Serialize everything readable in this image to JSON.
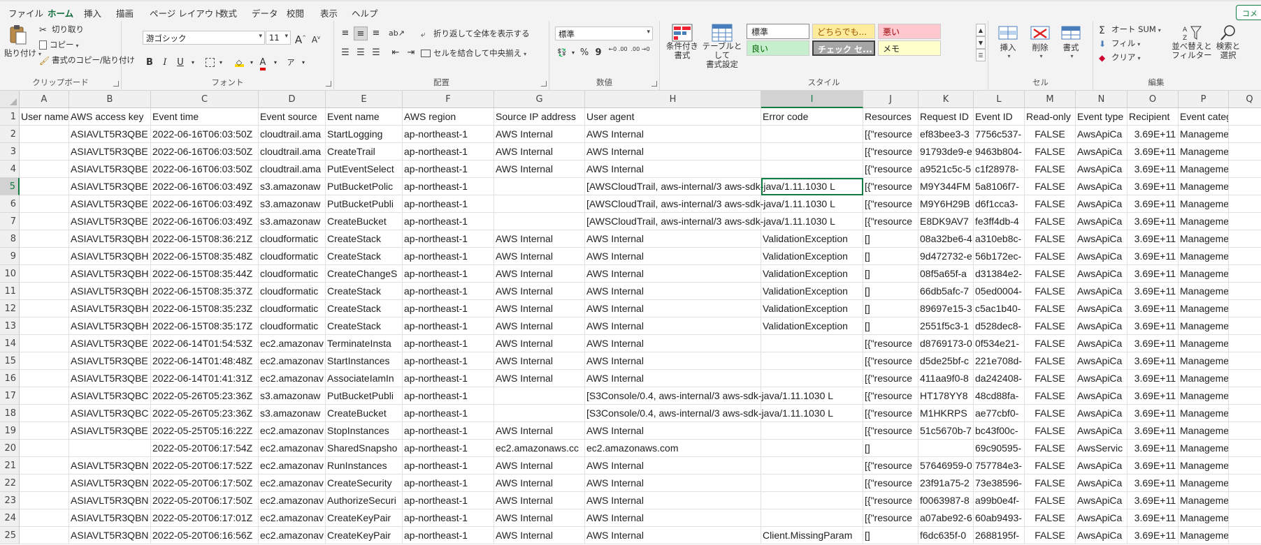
{
  "ribbon_tabs": [
    "ファイル",
    "ホーム",
    "挿入",
    "描画",
    "ページ レイアウト",
    "数式",
    "データ",
    "校閲",
    "表示",
    "ヘルプ"
  ],
  "active_tab": "ホーム",
  "comment_button": "コメ",
  "clipboard": {
    "paste": "貼り付け",
    "cut": "切り取り",
    "copy": "コピー",
    "format_painter": "書式のコピー/貼り付け",
    "label": "クリップボード"
  },
  "font": {
    "name": "游ゴシック",
    "size": "11",
    "grow": "A",
    "shrink": "A",
    "bold": "B",
    "italic": "I",
    "underline": "U",
    "color_letter": "A",
    "label": "フォント"
  },
  "alignment": {
    "wrap_text": "折り返して全体を表示する",
    "merge_center": "セルを結合して中央揃え",
    "label": "配置"
  },
  "number": {
    "format": "標準",
    "percent": "%",
    "comma": "9",
    "inc_decimal": "←0 .00",
    "dec_decimal": ".00 →0",
    "label": "数値"
  },
  "styles": {
    "conditional": "条件付き\n書式",
    "as_table": "テーブルとして\n書式設定",
    "cells": [
      {
        "text": "標準",
        "bg": "#ffffff",
        "fg": "#222222"
      },
      {
        "text": "どちらでも...",
        "bg": "#ffeb9c",
        "fg": "#9c5700"
      },
      {
        "text": "悪い",
        "bg": "#ffc7ce",
        "fg": "#9c0006"
      },
      {
        "text": "良い",
        "bg": "#c6efce",
        "fg": "#006100"
      },
      {
        "text": "チェック セ...",
        "bg": "#a5a5a5",
        "fg": "#ffffff"
      },
      {
        "text": "メモ",
        "bg": "#ffffcc",
        "fg": "#222222"
      }
    ],
    "label": "スタイル"
  },
  "cells_group": {
    "insert": "挿入",
    "delete": "削除",
    "format": "書式",
    "label": "セル"
  },
  "editing": {
    "autosum": "オート SUM",
    "fill": "フィル",
    "clear": "クリア",
    "sort_filter": "並べ替えと\nフィルター",
    "find_select": "検索と\n選択",
    "label": "編集"
  },
  "colors": {
    "accent": "#107c41",
    "ribbon_bg": "#f3f3f3"
  },
  "sheet": {
    "column_letters": [
      "A",
      "B",
      "C",
      "D",
      "E",
      "F",
      "G",
      "H",
      "I",
      "J",
      "K",
      "L",
      "M",
      "N",
      "O",
      "P",
      "Q"
    ],
    "selected_column": "I",
    "selected_row": 5,
    "header_row": [
      "User name",
      "AWS access key",
      "Event time",
      "Event source",
      "Event name",
      "AWS region",
      "Source IP address",
      "User agent",
      "Error code",
      "Resources",
      "Request ID",
      "Event ID",
      "Read-only",
      "Event type",
      "Recipient",
      "Event category",
      ""
    ],
    "rows": [
      [
        "",
        "ASIAVLT5R3QBE",
        "2022-06-16T06:03:50Z",
        "cloudtrail.ama",
        "StartLogging",
        "ap-northeast-1",
        "AWS Internal",
        "AWS Internal",
        "",
        "[{\"resource",
        "ef83bee3-3",
        "7756c537-",
        "FALSE",
        "AwsApiCa",
        "3.69E+11",
        "Management"
      ],
      [
        "",
        "ASIAVLT5R3QBE",
        "2022-06-16T06:03:50Z",
        "cloudtrail.ama",
        "CreateTrail",
        "ap-northeast-1",
        "AWS Internal",
        "AWS Internal",
        "",
        "[{\"resource",
        "91793de9-e",
        "9463b804-",
        "FALSE",
        "AwsApiCa",
        "3.69E+11",
        "Management"
      ],
      [
        "",
        "ASIAVLT5R3QBE",
        "2022-06-16T06:03:50Z",
        "cloudtrail.ama",
        "PutEventSelect",
        "ap-northeast-1",
        "AWS Internal",
        "AWS Internal",
        "",
        "[{\"resource",
        "a9521c5c-5",
        "c1f28978-",
        "FALSE",
        "AwsApiCa",
        "3.69E+11",
        "Management"
      ],
      [
        "",
        "ASIAVLT5R3QBE",
        "2022-06-16T06:03:49Z",
        "s3.amazonaw",
        "PutBucketPolic",
        "ap-northeast-1",
        "",
        "[AWSCloudTrail, aws-internal/3 aws-sdk-java/1.11.1030 L",
        "",
        "[{\"resource",
        "M9Y344FM",
        "5a8106f7-",
        "FALSE",
        "AwsApiCa",
        "3.69E+11",
        "Management"
      ],
      [
        "",
        "ASIAVLT5R3QBE",
        "2022-06-16T06:03:49Z",
        "s3.amazonaw",
        "PutBucketPubli",
        "ap-northeast-1",
        "",
        "[AWSCloudTrail, aws-internal/3 aws-sdk-java/1.11.1030 L",
        "",
        "[{\"resource",
        "M9Y6H29B",
        "d6f1cca3-",
        "FALSE",
        "AwsApiCa",
        "3.69E+11",
        "Management"
      ],
      [
        "",
        "ASIAVLT5R3QBE",
        "2022-06-16T06:03:49Z",
        "s3.amazonaw",
        "CreateBucket",
        "ap-northeast-1",
        "",
        "[AWSCloudTrail, aws-internal/3 aws-sdk-java/1.11.1030 L",
        "",
        "[{\"resource",
        "E8DK9AV7",
        "fe3ff4db-4",
        "FALSE",
        "AwsApiCa",
        "3.69E+11",
        "Management"
      ],
      [
        "",
        "ASIAVLT5R3QBH",
        "2022-06-15T08:36:21Z",
        "cloudformatic",
        "CreateStack",
        "ap-northeast-1",
        "AWS Internal",
        "AWS Internal",
        "ValidationException",
        "[]",
        "08a32be6-4",
        "a310eb8c-",
        "FALSE",
        "AwsApiCa",
        "3.69E+11",
        "Management"
      ],
      [
        "",
        "ASIAVLT5R3QBH",
        "2022-06-15T08:35:48Z",
        "cloudformatic",
        "CreateStack",
        "ap-northeast-1",
        "AWS Internal",
        "AWS Internal",
        "ValidationException",
        "[]",
        "9d472732-e",
        "56b172ec-",
        "FALSE",
        "AwsApiCa",
        "3.69E+11",
        "Management"
      ],
      [
        "",
        "ASIAVLT5R3QBH",
        "2022-06-15T08:35:44Z",
        "cloudformatic",
        "CreateChangeS",
        "ap-northeast-1",
        "AWS Internal",
        "AWS Internal",
        "ValidationException",
        "[]",
        "08f5a65f-a",
        "d31384e2-",
        "FALSE",
        "AwsApiCa",
        "3.69E+11",
        "Management"
      ],
      [
        "",
        "ASIAVLT5R3QBH",
        "2022-06-15T08:35:37Z",
        "cloudformatic",
        "CreateStack",
        "ap-northeast-1",
        "AWS Internal",
        "AWS Internal",
        "ValidationException",
        "[]",
        "66db5afc-7",
        "05ed0004-",
        "FALSE",
        "AwsApiCa",
        "3.69E+11",
        "Management"
      ],
      [
        "",
        "ASIAVLT5R3QBH",
        "2022-06-15T08:35:23Z",
        "cloudformatic",
        "CreateStack",
        "ap-northeast-1",
        "AWS Internal",
        "AWS Internal",
        "ValidationException",
        "[]",
        "89697e15-3",
        "c5ac1b40-",
        "FALSE",
        "AwsApiCa",
        "3.69E+11",
        "Management"
      ],
      [
        "",
        "ASIAVLT5R3QBH",
        "2022-06-15T08:35:17Z",
        "cloudformatic",
        "CreateStack",
        "ap-northeast-1",
        "AWS Internal",
        "AWS Internal",
        "ValidationException",
        "[]",
        "2551f5c3-1",
        "d528dec8-",
        "FALSE",
        "AwsApiCa",
        "3.69E+11",
        "Management"
      ],
      [
        "",
        "ASIAVLT5R3QBE",
        "2022-06-14T01:54:53Z",
        "ec2.amazonav",
        "TerminateInsta",
        "ap-northeast-1",
        "AWS Internal",
        "AWS Internal",
        "",
        "[{\"resource",
        "d8769173-0",
        "0f534e21-",
        "FALSE",
        "AwsApiCa",
        "3.69E+11",
        "Management"
      ],
      [
        "",
        "ASIAVLT5R3QBE",
        "2022-06-14T01:48:48Z",
        "ec2.amazonav",
        "StartInstances",
        "ap-northeast-1",
        "AWS Internal",
        "AWS Internal",
        "",
        "[{\"resource",
        "d5de25bf-c",
        "221e708d-",
        "FALSE",
        "AwsApiCa",
        "3.69E+11",
        "Management"
      ],
      [
        "",
        "ASIAVLT5R3QBE",
        "2022-06-14T01:41:31Z",
        "ec2.amazonav",
        "AssociateIamIn",
        "ap-northeast-1",
        "AWS Internal",
        "AWS Internal",
        "",
        "[{\"resource",
        "411aa9f0-8",
        "da242408-",
        "FALSE",
        "AwsApiCa",
        "3.69E+11",
        "Management"
      ],
      [
        "",
        "ASIAVLT5R3QBC",
        "2022-05-26T05:23:36Z",
        "s3.amazonaw",
        "PutBucketPubli",
        "ap-northeast-1",
        "",
        "[S3Console/0.4, aws-internal/3 aws-sdk-java/1.11.1030 L",
        "",
        "[{\"resource",
        "HT178YY8",
        "48cd88fa-",
        "FALSE",
        "AwsApiCa",
        "3.69E+11",
        "Management"
      ],
      [
        "",
        "ASIAVLT5R3QBC",
        "2022-05-26T05:23:36Z",
        "s3.amazonaw",
        "CreateBucket",
        "ap-northeast-1",
        "",
        "[S3Console/0.4, aws-internal/3 aws-sdk-java/1.11.1030 L",
        "",
        "[{\"resource",
        "M1HKRPS",
        "ae77cbf0-",
        "FALSE",
        "AwsApiCa",
        "3.69E+11",
        "Management"
      ],
      [
        "",
        "ASIAVLT5R3QBE",
        "2022-05-25T05:16:22Z",
        "ec2.amazonav",
        "StopInstances",
        "ap-northeast-1",
        "AWS Internal",
        "AWS Internal",
        "",
        "[{\"resource",
        "51c5670b-7",
        "bc43f00c-",
        "FALSE",
        "AwsApiCa",
        "3.69E+11",
        "Management"
      ],
      [
        "",
        "",
        "2022-05-20T06:17:54Z",
        "ec2.amazonav",
        "SharedSnapsho",
        "ap-northeast-1",
        "ec2.amazonaws.cc",
        "ec2.amazonaws.com",
        "",
        "[]",
        "",
        "69c90595-",
        "FALSE",
        "AwsServic",
        "3.69E+11",
        "Management"
      ],
      [
        "",
        "ASIAVLT5R3QBN",
        "2022-05-20T06:17:52Z",
        "ec2.amazonav",
        "RunInstances",
        "ap-northeast-1",
        "AWS Internal",
        "AWS Internal",
        "",
        "[{\"resource",
        "57646959-0",
        "757784e3-",
        "FALSE",
        "AwsApiCa",
        "3.69E+11",
        "Management"
      ],
      [
        "",
        "ASIAVLT5R3QBN",
        "2022-05-20T06:17:50Z",
        "ec2.amazonav",
        "CreateSecurity",
        "ap-northeast-1",
        "AWS Internal",
        "AWS Internal",
        "",
        "[{\"resource",
        "23f91a75-2",
        "73e38596-",
        "FALSE",
        "AwsApiCa",
        "3.69E+11",
        "Management"
      ],
      [
        "",
        "ASIAVLT5R3QBN",
        "2022-05-20T06:17:50Z",
        "ec2.amazonav",
        "AuthorizeSecuri",
        "ap-northeast-1",
        "AWS Internal",
        "AWS Internal",
        "",
        "[{\"resource",
        "f0063987-8",
        "a99b0e4f-",
        "FALSE",
        "AwsApiCa",
        "3.69E+11",
        "Management"
      ],
      [
        "",
        "ASIAVLT5R3QBN",
        "2022-05-20T06:17:01Z",
        "ec2.amazonav",
        "CreateKeyPair",
        "ap-northeast-1",
        "AWS Internal",
        "AWS Internal",
        "",
        "[{\"resource",
        "a07abe92-6",
        "60ab9493-",
        "FALSE",
        "AwsApiCa",
        "3.69E+11",
        "Management"
      ],
      [
        "",
        "ASIAVLT5R3QBN",
        "2022-05-20T06:16:56Z",
        "ec2.amazonav",
        "CreateKeyPair",
        "ap-northeast-1",
        "AWS Internal",
        "AWS Internal",
        "Client.MissingParam",
        "[]",
        "f6dc635f-0",
        "2688195f-",
        "FALSE",
        "AwsApiCa",
        "3.69E+11",
        "Management"
      ]
    ]
  }
}
